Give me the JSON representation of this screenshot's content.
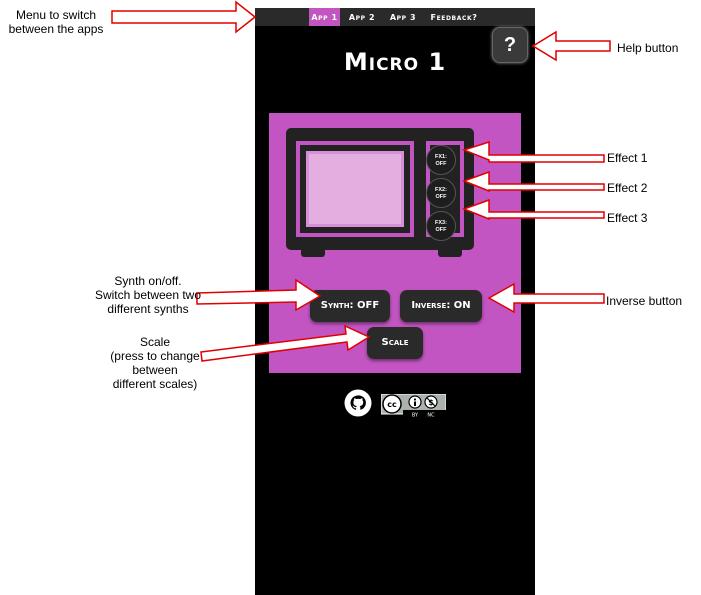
{
  "nav": {
    "tabs": [
      {
        "label": "App 1",
        "active": true
      },
      {
        "label": "App 2",
        "active": false
      },
      {
        "label": "App 3",
        "active": false
      },
      {
        "label": "Feedback?",
        "active": false
      }
    ]
  },
  "help": {
    "label": "?"
  },
  "app": {
    "title": "Micro 1",
    "fx_buttons": [
      {
        "line1": "FX1:",
        "line2": "OFF"
      },
      {
        "line1": "FX2:",
        "line2": "OFF"
      },
      {
        "line1": "FX3:",
        "line2": "OFF"
      }
    ],
    "synth_label": "Synth: OFF",
    "inverse_label": "Inverse: ON",
    "scale_label": "Scale"
  },
  "footer": {
    "cc_by": "BY",
    "cc_nc": "NC"
  },
  "annotations": {
    "menu": "Menu to switch\nbetween the apps",
    "help": "Help button",
    "effect1": "Effect 1",
    "effect2": "Effect 2",
    "effect3": "Effect 3",
    "synth": "Synth on/off.\nSwitch between two\ndifferent synths",
    "inverse": "Inverse button",
    "scale": "Scale\n(press to change\nbetween\ndifferent scales)"
  },
  "colors": {
    "accent": "#c255c2",
    "background": "#000000",
    "arrow": "#e00000"
  }
}
